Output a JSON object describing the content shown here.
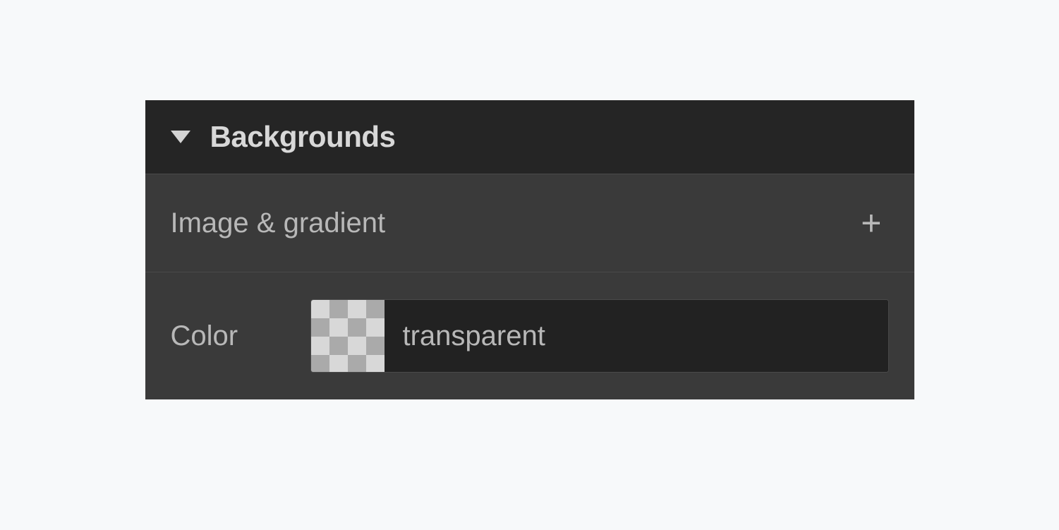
{
  "panel": {
    "title": "Backgrounds",
    "sections": {
      "imageGradient": {
        "label": "Image & gradient"
      },
      "color": {
        "label": "Color",
        "value": "transparent"
      }
    }
  }
}
